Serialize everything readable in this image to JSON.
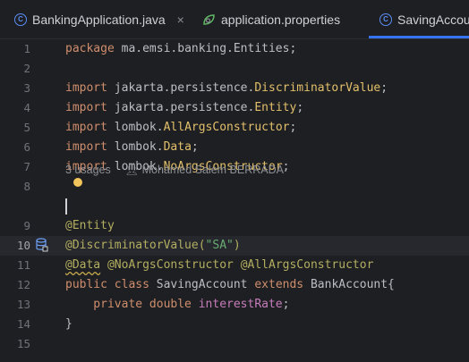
{
  "tabs": [
    {
      "label": "BankingApplication.java",
      "icon": "class-icon",
      "closable": true
    },
    {
      "label": "application.properties",
      "icon": "properties-leaf-icon",
      "closable": false
    },
    {
      "label": "SavingAccou",
      "icon": "class-icon",
      "active": true
    }
  ],
  "close_glyph": "×",
  "inlay_hint": {
    "usages": "3 usages",
    "author": "Mohamed Salem BERRADA"
  },
  "lines": [
    {
      "n": "1",
      "tokens": [
        {
          "t": "package ",
          "c": "kw"
        },
        {
          "t": "ma.emsi.banking.Entities;",
          "c": "plain"
        }
      ]
    },
    {
      "n": "2",
      "tokens": []
    },
    {
      "n": "3",
      "tokens": [
        {
          "t": "import ",
          "c": "kw"
        },
        {
          "t": "jakarta.persistence.",
          "c": "plain"
        },
        {
          "t": "DiscriminatorValue",
          "c": "cls"
        },
        {
          "t": ";",
          "c": "plain"
        }
      ]
    },
    {
      "n": "4",
      "tokens": [
        {
          "t": "import ",
          "c": "kw"
        },
        {
          "t": "jakarta.persistence.",
          "c": "plain"
        },
        {
          "t": "Entity",
          "c": "cls"
        },
        {
          "t": ";",
          "c": "plain"
        }
      ]
    },
    {
      "n": "5",
      "tokens": [
        {
          "t": "import ",
          "c": "kw"
        },
        {
          "t": "lombok.",
          "c": "plain"
        },
        {
          "t": "AllArgsConstructor",
          "c": "cls"
        },
        {
          "t": ";",
          "c": "plain"
        }
      ]
    },
    {
      "n": "6",
      "tokens": [
        {
          "t": "import ",
          "c": "kw"
        },
        {
          "t": "lombok.",
          "c": "plain"
        },
        {
          "t": "Data",
          "c": "cls"
        },
        {
          "t": ";",
          "c": "plain"
        }
      ]
    },
    {
      "n": "7",
      "tokens": [
        {
          "t": "import ",
          "c": "kw"
        },
        {
          "t": "lombok.",
          "c": "plain"
        },
        {
          "t": "NoArgsConstructor",
          "c": "cls"
        },
        {
          "t": ";",
          "c": "plain"
        }
      ]
    },
    {
      "n": "8",
      "tokens": []
    },
    {
      "n": "9",
      "tokens": [
        {
          "t": "@Entity",
          "c": "ann"
        }
      ]
    },
    {
      "n": "10",
      "tokens": [
        {
          "t": "@DiscriminatorValue(",
          "c": "ann"
        },
        {
          "t": "\"SA\"",
          "c": "str"
        },
        {
          "t": ")",
          "c": "ann"
        }
      ]
    },
    {
      "n": "11",
      "tokens": [
        {
          "t": "@Data",
          "c": "ann squiggle"
        },
        {
          "t": " ",
          "c": "plain"
        },
        {
          "t": "@NoArgsConstructor",
          "c": "ann"
        },
        {
          "t": " ",
          "c": "plain"
        },
        {
          "t": "@AllArgsConstructor",
          "c": "ann"
        }
      ]
    },
    {
      "n": "12",
      "tokens": [
        {
          "t": "public ",
          "c": "kw"
        },
        {
          "t": "class ",
          "c": "kw"
        },
        {
          "t": "SavingAccount ",
          "c": "plain"
        },
        {
          "t": "extends ",
          "c": "kw"
        },
        {
          "t": "BankAccount{",
          "c": "plain"
        }
      ]
    },
    {
      "n": "13",
      "tokens": [
        {
          "t": "    private ",
          "c": "kw"
        },
        {
          "t": "double ",
          "c": "kw"
        },
        {
          "t": "interestRate",
          "c": "field"
        },
        {
          "t": ";",
          "c": "plain"
        }
      ]
    },
    {
      "n": "14",
      "tokens": [
        {
          "t": "}",
          "c": "plain"
        }
      ]
    },
    {
      "n": "15",
      "tokens": []
    }
  ],
  "current_line": "10",
  "colors": {
    "background": "#1e1f22",
    "keyword": "#cf8e6d",
    "annotation": "#b3ae60",
    "string": "#6aab73",
    "field": "#c77dbb",
    "accent": "#3574f0"
  }
}
